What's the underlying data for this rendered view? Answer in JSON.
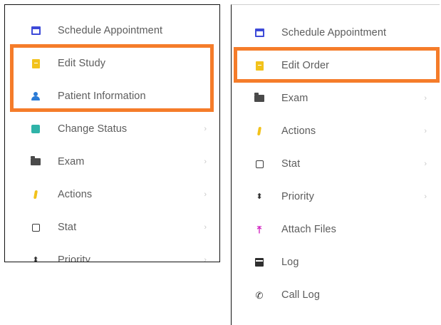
{
  "left_menu": {
    "items": [
      {
        "label": "Schedule Appointment",
        "icon": "calendar-icon",
        "submenu": false
      },
      {
        "label": "Edit Study",
        "icon": "file-icon",
        "submenu": false
      },
      {
        "label": "Patient Information",
        "icon": "person-icon",
        "submenu": false
      },
      {
        "label": "Change Status",
        "icon": "status-icon",
        "submenu": true
      },
      {
        "label": "Exam",
        "icon": "folder-icon",
        "submenu": true
      },
      {
        "label": "Actions",
        "icon": "bolt-icon",
        "submenu": true
      },
      {
        "label": "Stat",
        "icon": "checkbox-icon",
        "submenu": true
      },
      {
        "label": "Priority",
        "icon": "sort-icon",
        "submenu": true
      }
    ]
  },
  "right_menu": {
    "items": [
      {
        "label": "Schedule Appointment",
        "icon": "calendar-icon",
        "submenu": false
      },
      {
        "label": "Edit Order",
        "icon": "file-icon",
        "submenu": false
      },
      {
        "label": "Exam",
        "icon": "folder-icon",
        "submenu": true
      },
      {
        "label": "Actions",
        "icon": "bolt-icon",
        "submenu": true
      },
      {
        "label": "Stat",
        "icon": "checkbox-icon",
        "submenu": true
      },
      {
        "label": "Priority",
        "icon": "sort-icon",
        "submenu": true
      },
      {
        "label": "Attach Files",
        "icon": "upload-icon",
        "submenu": false
      },
      {
        "label": "Log",
        "icon": "archive-icon",
        "submenu": false
      },
      {
        "label": "Call Log",
        "icon": "phone-icon",
        "submenu": false
      }
    ]
  },
  "glyphs": {
    "chevron": "›",
    "sort": "⬍",
    "upload": "⤒",
    "phone": "✆"
  },
  "colors": {
    "highlight": "#f57c2a",
    "calendar": "#3d4ad8",
    "file": "#f2c21b",
    "person": "#2b7bd6",
    "status": "#2fb3a8",
    "upload": "#d11ec0"
  }
}
